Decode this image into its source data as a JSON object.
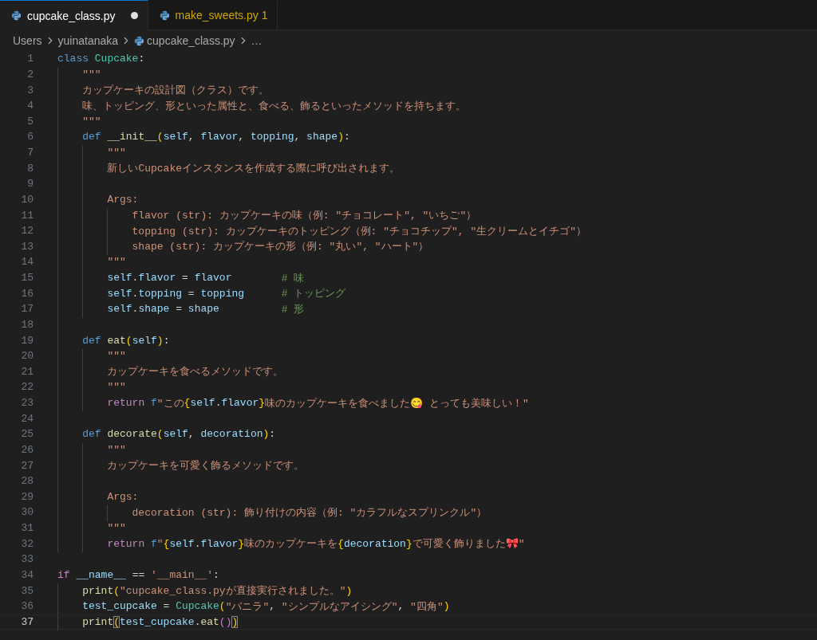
{
  "tabs": [
    {
      "label": "cupcake_class.py",
      "selected": true,
      "modified": true,
      "warning": false
    },
    {
      "label": "make_sweets.py",
      "selected": false,
      "modified": false,
      "warning": true,
      "problems": "1"
    }
  ],
  "breadcrumbs": [
    {
      "kind": "folder",
      "label": "Users"
    },
    {
      "kind": "folder",
      "label": "yuinatanaka"
    },
    {
      "kind": "file",
      "label": "cupcake_class.py"
    },
    {
      "kind": "more",
      "label": "…"
    }
  ],
  "editor": {
    "lines": [
      {
        "number": "1",
        "current": false,
        "tokens": [
          {
            "kind": "kw",
            "text": "class "
          },
          {
            "kind": "cls",
            "text": "Cupcake"
          },
          {
            "kind": "plain",
            "text": ":"
          }
        ],
        "children": [
          {
            "number": "2",
            "current": false,
            "tokens": [
              {
                "kind": "str",
                "text": "\"\"\""
              }
            ]
          },
          {
            "number": "3",
            "current": false,
            "tokens": [
              {
                "kind": "str",
                "text": "カップケーキの設計図（クラス）です。"
              }
            ]
          },
          {
            "number": "4",
            "current": false,
            "tokens": [
              {
                "kind": "str",
                "text": "味、トッピング、形といった属性と、食べる、飾るといったメソッドを持ちます。"
              }
            ]
          },
          {
            "number": "5",
            "current": false,
            "tokens": [
              {
                "kind": "str",
                "text": "\"\"\""
              }
            ]
          },
          {
            "number": "6",
            "current": false,
            "tokens": [
              {
                "kind": "kw",
                "text": "def "
              },
              {
                "kind": "fn",
                "text": "__init__"
              },
              {
                "kind": "br1",
                "text": "("
              },
              {
                "kind": "var",
                "text": "self"
              },
              {
                "kind": "plain",
                "text": ", "
              },
              {
                "kind": "var",
                "text": "flavor"
              },
              {
                "kind": "plain",
                "text": ", "
              },
              {
                "kind": "var",
                "text": "topping"
              },
              {
                "kind": "plain",
                "text": ", "
              },
              {
                "kind": "var",
                "text": "shape"
              },
              {
                "kind": "br1",
                "text": ")"
              },
              {
                "kind": "plain",
                "text": ":"
              }
            ],
            "children": [
              {
                "number": "7",
                "current": false,
                "tokens": [
                  {
                    "kind": "str",
                    "text": "\"\"\""
                  }
                ]
              },
              {
                "number": "8",
                "current": false,
                "tokens": [
                  {
                    "kind": "str",
                    "text": "新しいCupcakeインスタンスを作成する際に呼び出されます。"
                  }
                ]
              },
              {
                "number": "9",
                "current": false
              },
              {
                "number": "10",
                "current": false,
                "tokens": [
                  {
                    "kind": "str",
                    "text": "Args:"
                  }
                ],
                "children": [
                  {
                    "number": "11",
                    "current": false,
                    "tokens": [
                      {
                        "kind": "str",
                        "text": "flavor (str): カップケーキの味（例: \"チョコレート\", \"いちご\"）"
                      }
                    ]
                  },
                  {
                    "number": "12",
                    "current": false,
                    "tokens": [
                      {
                        "kind": "str",
                        "text": "topping (str): カップケーキのトッピング（例: \"チョコチップ\", \"生クリームとイチゴ\"）"
                      }
                    ]
                  },
                  {
                    "number": "13",
                    "current": false,
                    "tokens": [
                      {
                        "kind": "str",
                        "text": "shape (str): カップケーキの形（例: \"丸い\", \"ハート\"）"
                      }
                    ]
                  }
                ]
              },
              {
                "number": "14",
                "current": false,
                "tokens": [
                  {
                    "kind": "str",
                    "text": "\"\"\""
                  }
                ]
              },
              {
                "number": "15",
                "current": false,
                "tokens": [
                  {
                    "kind": "var",
                    "text": "self"
                  },
                  {
                    "kind": "plain",
                    "text": "."
                  },
                  {
                    "kind": "var",
                    "text": "flavor"
                  },
                  {
                    "kind": "plain",
                    "text": " = "
                  },
                  {
                    "kind": "var",
                    "text": "flavor        "
                  },
                  {
                    "kind": "cm",
                    "text": "# 味"
                  }
                ]
              },
              {
                "number": "16",
                "current": false,
                "tokens": [
                  {
                    "kind": "var",
                    "text": "self"
                  },
                  {
                    "kind": "plain",
                    "text": "."
                  },
                  {
                    "kind": "var",
                    "text": "topping"
                  },
                  {
                    "kind": "plain",
                    "text": " = "
                  },
                  {
                    "kind": "var",
                    "text": "topping      "
                  },
                  {
                    "kind": "cm",
                    "text": "# トッピング"
                  }
                ]
              },
              {
                "number": "17",
                "current": false,
                "tokens": [
                  {
                    "kind": "var",
                    "text": "self"
                  },
                  {
                    "kind": "plain",
                    "text": "."
                  },
                  {
                    "kind": "var",
                    "text": "shape"
                  },
                  {
                    "kind": "plain",
                    "text": " = "
                  },
                  {
                    "kind": "var",
                    "text": "shape          "
                  },
                  {
                    "kind": "cm",
                    "text": "# 形"
                  }
                ]
              }
            ]
          },
          {
            "number": "18",
            "current": false
          },
          {
            "number": "19",
            "current": false,
            "tokens": [
              {
                "kind": "kw",
                "text": "def "
              },
              {
                "kind": "fn",
                "text": "eat"
              },
              {
                "kind": "br1",
                "text": "("
              },
              {
                "kind": "var",
                "text": "self"
              },
              {
                "kind": "br1",
                "text": ")"
              },
              {
                "kind": "plain",
                "text": ":"
              }
            ],
            "children": [
              {
                "number": "20",
                "current": false,
                "tokens": [
                  {
                    "kind": "str",
                    "text": "\"\"\""
                  }
                ]
              },
              {
                "number": "21",
                "current": false,
                "tokens": [
                  {
                    "kind": "str",
                    "text": "カップケーキを食べるメソッドです。"
                  }
                ]
              },
              {
                "number": "22",
                "current": false,
                "tokens": [
                  {
                    "kind": "str",
                    "text": "\"\"\""
                  }
                ]
              },
              {
                "number": "23",
                "current": false,
                "tokens": [
                  {
                    "kind": "ctrl",
                    "text": "return "
                  },
                  {
                    "kind": "kw",
                    "text": "f"
                  },
                  {
                    "kind": "str",
                    "text": "\"この"
                  },
                  {
                    "kind": "br1",
                    "text": "{"
                  },
                  {
                    "kind": "var",
                    "text": "self"
                  },
                  {
                    "kind": "plain",
                    "text": "."
                  },
                  {
                    "kind": "var",
                    "text": "flavor"
                  },
                  {
                    "kind": "br1",
                    "text": "}"
                  },
                  {
                    "kind": "str",
                    "text": "味のカップケーキを食べました😋 とっても美味しい！\""
                  }
                ]
              }
            ]
          },
          {
            "number": "24",
            "current": false
          },
          {
            "number": "25",
            "current": false,
            "tokens": [
              {
                "kind": "kw",
                "text": "def "
              },
              {
                "kind": "fn",
                "text": "decorate"
              },
              {
                "kind": "br1",
                "text": "("
              },
              {
                "kind": "var",
                "text": "self"
              },
              {
                "kind": "plain",
                "text": ", "
              },
              {
                "kind": "var",
                "text": "decoration"
              },
              {
                "kind": "br1",
                "text": ")"
              },
              {
                "kind": "plain",
                "text": ":"
              }
            ],
            "children": [
              {
                "number": "26",
                "current": false,
                "tokens": [
                  {
                    "kind": "str",
                    "text": "\"\"\""
                  }
                ]
              },
              {
                "number": "27",
                "current": false,
                "tokens": [
                  {
                    "kind": "str",
                    "text": "カップケーキを可愛く飾るメソッドです。"
                  }
                ]
              },
              {
                "number": "28",
                "current": false
              },
              {
                "number": "29",
                "current": false,
                "tokens": [
                  {
                    "kind": "str",
                    "text": "Args:"
                  }
                ],
                "children": [
                  {
                    "number": "30",
                    "current": false,
                    "tokens": [
                      {
                        "kind": "str",
                        "text": "decoration (str): 飾り付けの内容（例: \"カラフルなスプリンクル\"）"
                      }
                    ]
                  }
                ]
              },
              {
                "number": "31",
                "current": false,
                "tokens": [
                  {
                    "kind": "str",
                    "text": "\"\"\""
                  }
                ]
              },
              {
                "number": "32",
                "current": false,
                "tokens": [
                  {
                    "kind": "ctrl",
                    "text": "return "
                  },
                  {
                    "kind": "kw",
                    "text": "f"
                  },
                  {
                    "kind": "str",
                    "text": "\""
                  },
                  {
                    "kind": "br1",
                    "text": "{"
                  },
                  {
                    "kind": "var",
                    "text": "self"
                  },
                  {
                    "kind": "plain",
                    "text": "."
                  },
                  {
                    "kind": "var",
                    "text": "flavor"
                  },
                  {
                    "kind": "br1",
                    "text": "}"
                  },
                  {
                    "kind": "str",
                    "text": "味のカップケーキを"
                  },
                  {
                    "kind": "br1",
                    "text": "{"
                  },
                  {
                    "kind": "var",
                    "text": "decoration"
                  },
                  {
                    "kind": "br1",
                    "text": "}"
                  },
                  {
                    "kind": "str",
                    "text": "で可愛く飾りました🎀\""
                  }
                ]
              }
            ]
          }
        ]
      },
      {
        "number": "33",
        "current": false
      },
      {
        "number": "34",
        "current": false,
        "tokens": [
          {
            "kind": "ctrl",
            "text": "if "
          },
          {
            "kind": "var",
            "text": "__name__"
          },
          {
            "kind": "plain",
            "text": " == "
          },
          {
            "kind": "str",
            "text": "'__main__'"
          },
          {
            "kind": "plain",
            "text": ":"
          }
        ],
        "children": [
          {
            "number": "35",
            "current": false,
            "tokens": [
              {
                "kind": "fn",
                "text": "print"
              },
              {
                "kind": "br1",
                "text": "("
              },
              {
                "kind": "str",
                "text": "\"cupcake_class.pyが直接実行されました。\""
              },
              {
                "kind": "br1",
                "text": ")"
              }
            ]
          },
          {
            "number": "36",
            "current": false,
            "tokens": [
              {
                "kind": "var",
                "text": "test_cupcake"
              },
              {
                "kind": "plain",
                "text": " = "
              },
              {
                "kind": "cls",
                "text": "Cupcake"
              },
              {
                "kind": "br1",
                "text": "("
              },
              {
                "kind": "str",
                "text": "\"バニラ\""
              },
              {
                "kind": "plain",
                "text": ", "
              },
              {
                "kind": "str",
                "text": "\"シンプルなアイシング\""
              },
              {
                "kind": "plain",
                "text": ", "
              },
              {
                "kind": "str",
                "text": "\"四角\""
              },
              {
                "kind": "br1",
                "text": ")"
              }
            ]
          },
          {
            "number": "37",
            "current": true,
            "tokens": [
              {
                "kind": "fn",
                "text": "print"
              },
              {
                "kind": "br1m",
                "text": "("
              },
              {
                "kind": "var",
                "text": "test_cupcake"
              },
              {
                "kind": "plain",
                "text": "."
              },
              {
                "kind": "fn",
                "text": "eat"
              },
              {
                "kind": "br2",
                "text": "("
              },
              {
                "kind": "br2",
                "text": ")"
              },
              {
                "kind": "br1m",
                "text": ")"
              }
            ]
          }
        ]
      }
    ]
  }
}
